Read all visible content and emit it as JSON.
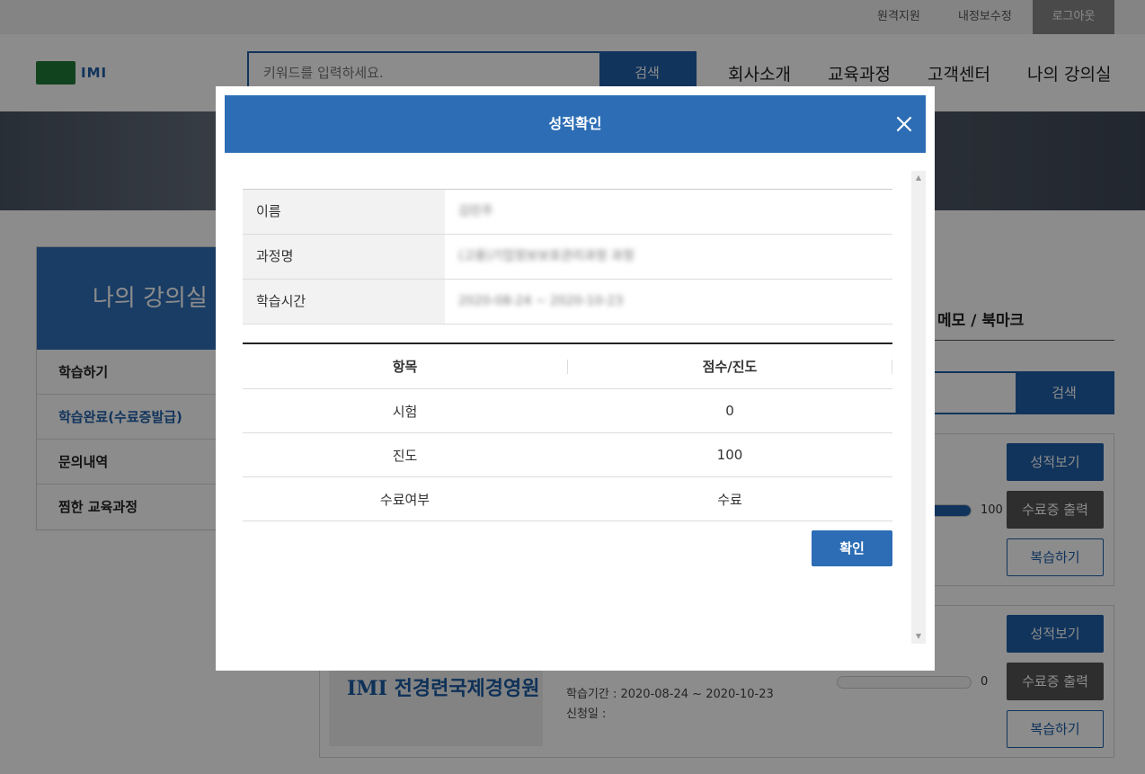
{
  "topbar": {
    "remote_support": "원격지원",
    "edit_info": "내정보수정",
    "logout": "로그아웃"
  },
  "header": {
    "search_placeholder": "키워드를 입력하세요.",
    "search_button": "검색",
    "nav": [
      "회사소개",
      "교육과정",
      "고객센터",
      "나의 강의실"
    ]
  },
  "sidebar": {
    "title": "나의 강의실",
    "items": [
      {
        "label": "학습하기"
      },
      {
        "label": "학습완료(수료증발급)"
      },
      {
        "label": "문의내역"
      },
      {
        "label": "찜한 교육과정"
      }
    ]
  },
  "content": {
    "tab_memo": "메모 / 북마크",
    "search_button": "검색",
    "courses": [
      {
        "progress": 100,
        "progress_label": "100",
        "btn_grade": "성적보기",
        "btn_cert": "수료증 출력",
        "btn_review": "복습하기"
      },
      {
        "thumb_text": "IMI 전경련국제경영원",
        "period": "학습기간 : 2020-08-24 ~ 2020-10-23",
        "applied": "신청일 :",
        "progress": 0,
        "progress_label": "0",
        "btn_grade": "성적보기",
        "btn_cert": "수료증 출력",
        "btn_review": "복습하기"
      }
    ]
  },
  "modal": {
    "title": "성적확인",
    "info": [
      {
        "label": "이름",
        "value": "김민주"
      },
      {
        "label": "과정명",
        "value": "(고용)기업정보보호관리과정 과정"
      },
      {
        "label": "학습시간",
        "value": "2020-08-24 ~ 2020-10-23"
      }
    ],
    "grade_headers": [
      "항목",
      "점수/진도"
    ],
    "grade_rows": [
      {
        "item": "시험",
        "score": "0"
      },
      {
        "item": "진도",
        "score": "100"
      },
      {
        "item": "수료여부",
        "score": "수료"
      }
    ],
    "confirm": "확인"
  }
}
